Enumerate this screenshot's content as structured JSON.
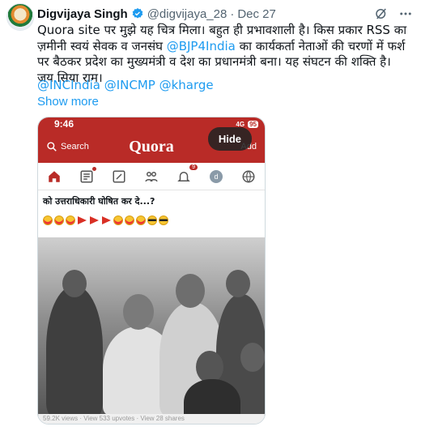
{
  "author": {
    "name": "Digvijaya Singh",
    "handle": "@digvijaya_28",
    "separator": "·",
    "date": "Dec 27"
  },
  "tweet": {
    "line1_part1": "Quora site पर मुझे यह चित्र मिला। बहुत ही प्रभावशाली है। किस प्रकार RSS का ज़मीनी स्वयं सेवक व जनसंघ ",
    "mention_bjp": "@BJP4India",
    "line1_part2": " का कार्यकर्ता नेताओं की चरणों में फर्श पर बैठकर प्रदेश का मुख्यमंत्री व देश का प्रधानमंत्री बना। यह संघटन की शक्ति है।",
    "line2": "जय सिया राम।",
    "mentions": "@INCIndia @INCMP @kharge",
    "show_more": "Show more"
  },
  "media": {
    "hide_label": "Hide",
    "status_time": "9:46",
    "status_network": "4G",
    "status_battery": "95",
    "search_label": "Search",
    "logo": "Quora",
    "add_label": "Add",
    "notif_badge": "9",
    "avatar_letter": "d",
    "question_text": "को उत्तराधिकारी घोषित कर दे...?",
    "stats_text": "59.2K views · View 533 upvotes · View 28 shares"
  },
  "icons": [
    "verified-icon",
    "grok-icon",
    "more-icon",
    "search-icon",
    "home-icon",
    "list-icon",
    "edit-icon",
    "people-icon",
    "bell-icon",
    "globe-icon"
  ],
  "colors": {
    "link": "#1d9bf0",
    "quora_red": "#b92b27",
    "text": "#0f1419",
    "secondary": "#536471"
  }
}
